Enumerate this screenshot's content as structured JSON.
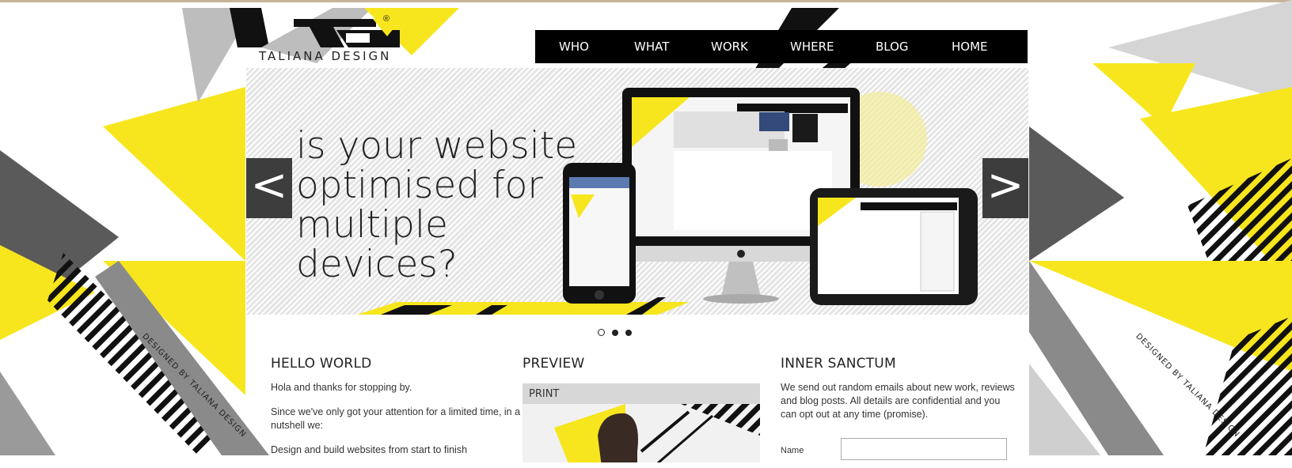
{
  "brand": {
    "name": "TALIANA DESIGN",
    "mark": "®"
  },
  "nav": [
    "WHO",
    "WHAT",
    "WORK",
    "WHERE",
    "BLOG",
    "HOME"
  ],
  "slider": {
    "headline": "is your website optimised for multiple devices?",
    "prev_label": "<",
    "next_label": ">",
    "slides": 3,
    "active_slide": 1
  },
  "colors": {
    "accent": "#f7e61d",
    "dark": "#3d3d3d",
    "nav_bg": "#000000"
  },
  "sections": {
    "hello": {
      "title": "HELLO WORLD",
      "p1": "Hola and thanks for stopping by.",
      "p2": "Since we've only got your attention for a limited time, in a nutshell we:",
      "p3": "Design and build websites from start to finish"
    },
    "preview": {
      "title": "PREVIEW",
      "tab": "PRINT"
    },
    "inner": {
      "title": "INNER SANCTUM",
      "p1": "We send out random emails about new work, reviews and blog posts. All details are confidential and you can opt out at any time (promise).",
      "name_label": "Name",
      "name_value": ""
    }
  },
  "credit": "DESIGNED BY TALIANA DESIGN"
}
